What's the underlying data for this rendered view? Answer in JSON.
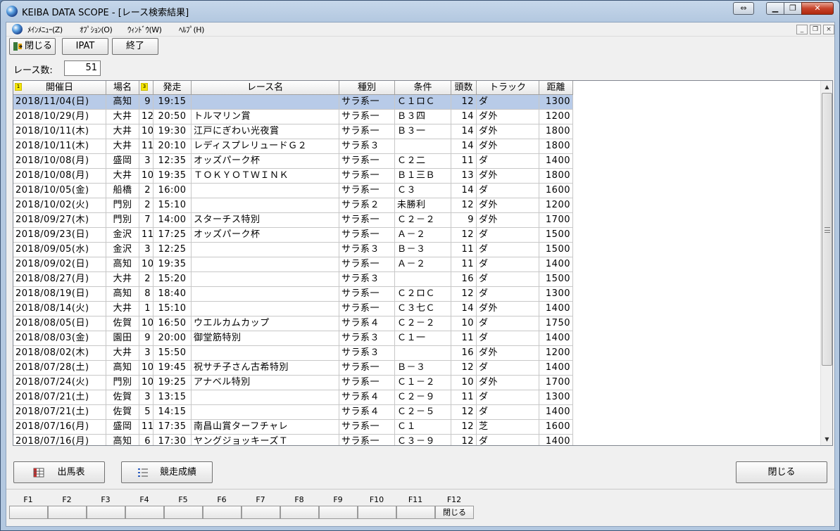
{
  "window": {
    "title": "KEIBA DATA SCOPE - [レース検索結果]"
  },
  "menu": [
    {
      "label": "ﾒｲﾝﾒﾆｭｰ(Z)"
    },
    {
      "label": "ｵﾌﾟｼｮﾝ(O)"
    },
    {
      "label": "ｳｨﾝﾄﾞｳ(W)"
    },
    {
      "label": "ﾍﾙﾌﾟ(H)"
    }
  ],
  "toolbar": {
    "close_label": "閉じる",
    "ipat_label": "IPAT",
    "exit_label": "終了"
  },
  "count": {
    "label": "レース数:",
    "value": "51"
  },
  "grid": {
    "columns": [
      "開催日",
      "場名",
      "",
      "発走",
      "レース名",
      "種別",
      "条件",
      "頭数",
      "トラック",
      "距離"
    ],
    "sort_badges": [
      "1",
      "3"
    ],
    "rows": [
      [
        "2018/11/04(日)",
        "高知",
        "9",
        "19:15",
        "",
        "サラ系一",
        "Ｃ１ロＣ",
        "12",
        "ダ",
        "1300"
      ],
      [
        "2018/10/29(月)",
        "大井",
        "12",
        "20:50",
        "トルマリン賞",
        "サラ系一",
        "Ｂ３四",
        "14",
        "ダ外",
        "1200"
      ],
      [
        "2018/10/11(木)",
        "大井",
        "10",
        "19:30",
        "江戸にぎわい光夜賞",
        "サラ系一",
        "Ｂ３一",
        "14",
        "ダ外",
        "1800"
      ],
      [
        "2018/10/11(木)",
        "大井",
        "11",
        "20:10",
        "レディスプレリュードＧ２",
        "サラ系３",
        "",
        "14",
        "ダ外",
        "1800"
      ],
      [
        "2018/10/08(月)",
        "盛岡",
        "3",
        "12:35",
        "オッズパーク杯",
        "サラ系一",
        "Ｃ２二",
        "11",
        "ダ",
        "1400"
      ],
      [
        "2018/10/08(月)",
        "大井",
        "10",
        "19:35",
        "ＴＯＫＹＯＴＷＩＮＫ",
        "サラ系一",
        "Ｂ１三Ｂ",
        "13",
        "ダ外",
        "1800"
      ],
      [
        "2018/10/05(金)",
        "船橋",
        "2",
        "16:00",
        "",
        "サラ系一",
        "Ｃ３",
        "14",
        "ダ",
        "1600"
      ],
      [
        "2018/10/02(火)",
        "門別",
        "2",
        "15:10",
        "",
        "サラ系２",
        "未勝利",
        "12",
        "ダ外",
        "1200"
      ],
      [
        "2018/09/27(木)",
        "門別",
        "7",
        "14:00",
        "スターチス特別",
        "サラ系一",
        "Ｃ２－２",
        "9",
        "ダ外",
        "1700"
      ],
      [
        "2018/09/23(日)",
        "金沢",
        "11",
        "17:25",
        "オッズパーク杯",
        "サラ系一",
        "Ａ－２",
        "12",
        "ダ",
        "1500"
      ],
      [
        "2018/09/05(水)",
        "金沢",
        "3",
        "12:25",
        "",
        "サラ系３",
        "Ｂ－３",
        "11",
        "ダ",
        "1500"
      ],
      [
        "2018/09/02(日)",
        "高知",
        "10",
        "19:35",
        "",
        "サラ系一",
        "Ａ－２",
        "11",
        "ダ",
        "1400"
      ],
      [
        "2018/08/27(月)",
        "大井",
        "2",
        "15:20",
        "",
        "サラ系３",
        "",
        "16",
        "ダ",
        "1500"
      ],
      [
        "2018/08/19(日)",
        "高知",
        "8",
        "18:40",
        "",
        "サラ系一",
        "Ｃ２ロＣ",
        "12",
        "ダ",
        "1300"
      ],
      [
        "2018/08/14(火)",
        "大井",
        "1",
        "15:10",
        "",
        "サラ系一",
        "Ｃ３七Ｃ",
        "14",
        "ダ外",
        "1400"
      ],
      [
        "2018/08/05(日)",
        "佐賀",
        "10",
        "16:50",
        "ウエルカムカップ",
        "サラ系４",
        "Ｃ２－２",
        "10",
        "ダ",
        "1750"
      ],
      [
        "2018/08/03(金)",
        "園田",
        "9",
        "20:00",
        "御堂筋特別",
        "サラ系３",
        "Ｃ１一",
        "11",
        "ダ",
        "1400"
      ],
      [
        "2018/08/02(木)",
        "大井",
        "3",
        "15:50",
        "",
        "サラ系３",
        "",
        "16",
        "ダ外",
        "1200"
      ],
      [
        "2018/07/28(土)",
        "高知",
        "10",
        "19:45",
        "祝サチ子さん古希特別",
        "サラ系一",
        "Ｂ－３",
        "12",
        "ダ",
        "1400"
      ],
      [
        "2018/07/24(火)",
        "門別",
        "10",
        "19:25",
        "アナベル特別",
        "サラ系一",
        "Ｃ１－２",
        "10",
        "ダ外",
        "1700"
      ],
      [
        "2018/07/21(土)",
        "佐賀",
        "3",
        "13:15",
        "",
        "サラ系４",
        "Ｃ２－９",
        "11",
        "ダ",
        "1300"
      ],
      [
        "2018/07/21(土)",
        "佐賀",
        "5",
        "14:15",
        "",
        "サラ系４",
        "Ｃ２－５",
        "12",
        "ダ",
        "1400"
      ],
      [
        "2018/07/16(月)",
        "盛岡",
        "11",
        "17:35",
        "南昌山賞ターフチャレ",
        "サラ系一",
        "Ｃ１",
        "12",
        "芝",
        "1600"
      ],
      [
        "2018/07/16(月)",
        "高知",
        "6",
        "17:30",
        "ヤングジョッキーズＴ",
        "サラ系一",
        "Ｃ３－９",
        "12",
        "ダ",
        "1400"
      ]
    ]
  },
  "bottom_buttons": {
    "entries_label": "出馬表",
    "results_label": "競走成績",
    "close_label": "閉じる"
  },
  "function_keys": [
    {
      "key": "F1",
      "label": ""
    },
    {
      "key": "F2",
      "label": ""
    },
    {
      "key": "F3",
      "label": ""
    },
    {
      "key": "F4",
      "label": ""
    },
    {
      "key": "F5",
      "label": ""
    },
    {
      "key": "F6",
      "label": ""
    },
    {
      "key": "F7",
      "label": ""
    },
    {
      "key": "F8",
      "label": ""
    },
    {
      "key": "F9",
      "label": ""
    },
    {
      "key": "F10",
      "label": ""
    },
    {
      "key": "F11",
      "label": ""
    },
    {
      "key": "F12",
      "label": "閉じる"
    }
  ],
  "colors": {
    "selected_row": "#b8cbe8",
    "sort_badge": "#f5e600",
    "close_button": "#c7432b"
  }
}
